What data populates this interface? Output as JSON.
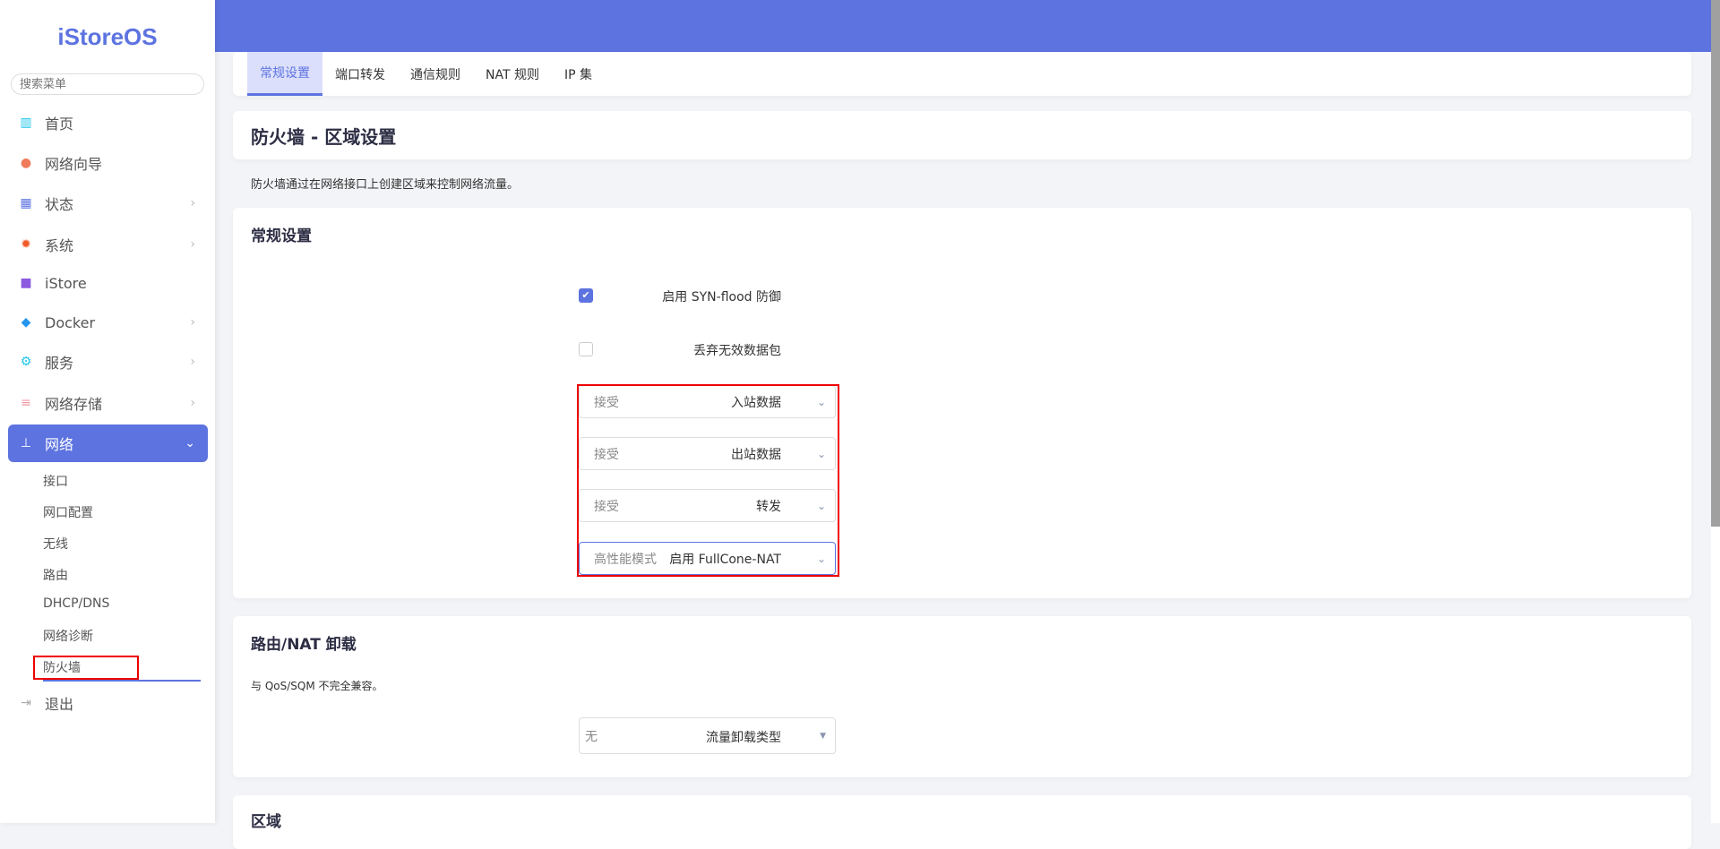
{
  "brand": "iStoreOS",
  "search": {
    "placeholder": "搜索菜单"
  },
  "nav": [
    {
      "label": "首页",
      "icon": "dashboard-icon",
      "color": "#1ec6e8"
    },
    {
      "label": "网络向导",
      "icon": "globe-icon",
      "color": "#f07a5a"
    },
    {
      "label": "状态",
      "icon": "grid-icon",
      "color": "#5d73e0"
    },
    {
      "label": "系统",
      "icon": "gear-icon",
      "color": "#f05a2a"
    },
    {
      "label": "iStore",
      "icon": "bag-icon",
      "color": "#8a5ae0"
    },
    {
      "label": "Docker",
      "icon": "docker-icon",
      "color": "#2496ed"
    },
    {
      "label": "服务",
      "icon": "cogs-icon",
      "color": "#1ec6e8"
    },
    {
      "label": "网络存储",
      "icon": "database-icon",
      "color": "#f09aa6"
    },
    {
      "label": "网络",
      "icon": "sitemap-icon",
      "color": "#ffffff"
    }
  ],
  "subnav": [
    "接口",
    "网口配置",
    "无线",
    "路由",
    "DHCP/DNS",
    "网络诊断",
    "防火墙"
  ],
  "logout": "退出",
  "tabs": [
    "常规设置",
    "端口转发",
    "通信规则",
    "NAT 规则",
    "IP 集"
  ],
  "page_title": "防火墙 - 区域设置",
  "page_desc": "防火墙通过在网络接口上创建区域来控制网络流量。",
  "general": {
    "title": "常规设置",
    "syn_label": "启用 SYN-flood 防御",
    "syn_checked": true,
    "drop_label": "丢弃无效数据包",
    "drop_checked": false,
    "input_label": "入站数据",
    "input_value": "接受",
    "output_label": "出站数据",
    "output_value": "接受",
    "forward_label": "转发",
    "forward_value": "接受",
    "fullcone_label": "启用 FullCone-NAT",
    "fullcone_value": "高性能模式"
  },
  "offload": {
    "title": "路由/NAT 卸载",
    "note": "与 QoS/SQM 不完全兼容。",
    "type_label": "流量卸载类型",
    "type_value": "无"
  },
  "zones": {
    "title": "区域"
  },
  "colors": {
    "accent": "#5d73e0",
    "highlight": "#ee0000"
  }
}
